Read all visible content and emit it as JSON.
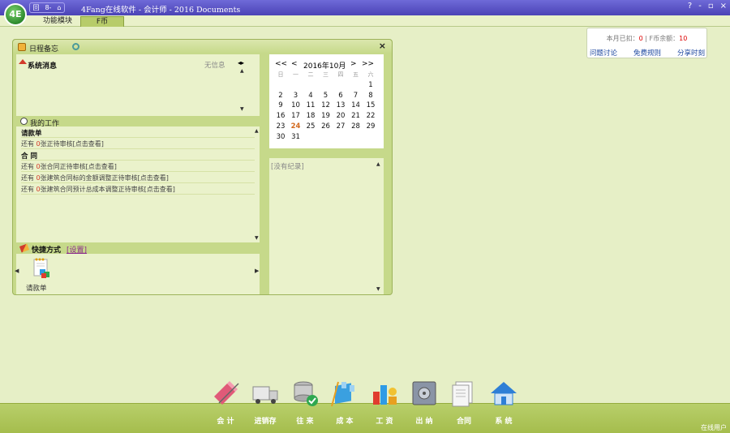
{
  "app": {
    "logo_text": "4E",
    "window_title": "4Fang在线软件 - 会计师 - 2016 Documents",
    "quick_access": [
      "回",
      "8-",
      "⌂"
    ],
    "window_controls": [
      "?",
      "-",
      "▫",
      "×"
    ]
  },
  "tabs": [
    "功能模块",
    "F币"
  ],
  "info": {
    "deducted_label": "本月已扣：",
    "deducted_value": "0",
    "divider": "|",
    "balance_label": "F币余额：",
    "balance_value": "10",
    "links": [
      "问题讨论",
      "免费规则",
      "分享时刻"
    ]
  },
  "panel": {
    "title": "日程备忘",
    "close": "×",
    "system_messages": {
      "title": "系统消息",
      "empty": "无信息",
      "nav": "◂▸"
    },
    "my_work": {
      "title": "我的工作",
      "rows": [
        {
          "type": "head",
          "text": "请款单"
        },
        {
          "type": "item",
          "pre": "还有 ",
          "num": "0",
          "post": "张正待审核[点击查看]"
        },
        {
          "type": "head",
          "text": "合 同"
        },
        {
          "type": "item",
          "pre": "还有 ",
          "num": "0",
          "post": "张合同正待审核[点击查看]"
        },
        {
          "type": "item",
          "pre": "还有 ",
          "num": "0",
          "post": "张建筑合同标的金额调整正待审核[点击查看]"
        },
        {
          "type": "item",
          "pre": "还有 ",
          "num": "0",
          "post": "张建筑合同预计总成本调整正待审核[点击查看]"
        }
      ]
    },
    "shortcuts": {
      "title": "快捷方式",
      "settings": "[设置]",
      "items": [
        {
          "label": "请款单",
          "icon": "payment-request-icon"
        }
      ]
    },
    "calendar": {
      "prev_year": "<<",
      "prev_month": "<",
      "month_label": "2016年10月",
      "next_month": ">",
      "next_year": ">>",
      "weekdays": [
        "日",
        "一",
        "二",
        "三",
        "四",
        "五",
        "六"
      ],
      "first_weekday": 6,
      "days_in_month": 31,
      "today": 24
    },
    "records": {
      "empty": "[没有纪录]"
    }
  },
  "dock": {
    "modules": [
      {
        "label": "会 计",
        "icon": "accounting-icon"
      },
      {
        "label": "进销存",
        "icon": "inventory-truck-icon"
      },
      {
        "label": "往 来",
        "icon": "transactions-icon"
      },
      {
        "label": "成 本",
        "icon": "cost-icon"
      },
      {
        "label": "工 资",
        "icon": "salary-icon"
      },
      {
        "label": "出 纳",
        "icon": "cashier-safe-icon"
      },
      {
        "label": "合同",
        "icon": "contract-icon"
      },
      {
        "label": "系 统",
        "icon": "system-house-icon"
      }
    ],
    "online_label": "在线用户"
  }
}
